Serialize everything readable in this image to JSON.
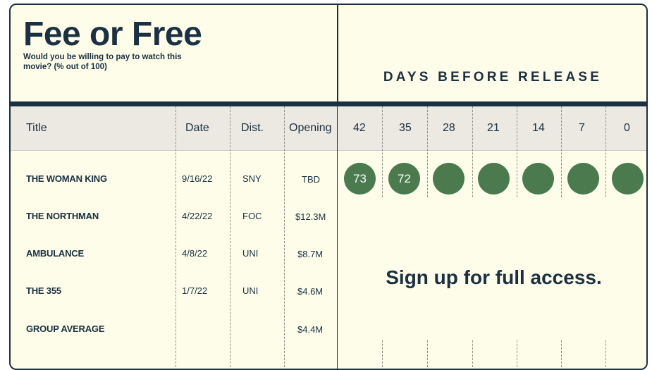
{
  "header": {
    "title": "Fee or Free",
    "subtitle": "Would you be willing to pay to watch this movie? (% out of 100)",
    "days_label": "DAYS BEFORE RELEASE"
  },
  "columns": {
    "title": "Title",
    "date": "Date",
    "dist": "Dist.",
    "opening": "Opening",
    "days": [
      "42",
      "35",
      "28",
      "21",
      "14",
      "7",
      "0"
    ]
  },
  "rows": [
    {
      "title": "THE WOMAN KING",
      "date": "9/16/22",
      "dist": "SNY",
      "opening": "TBD",
      "scores": [
        "73",
        "72",
        "",
        "",
        "",
        "",
        ""
      ]
    },
    {
      "title": "THE NORTHMAN",
      "date": "4/22/22",
      "dist": "FOC",
      "opening": "$12.3M"
    },
    {
      "title": "AMBULANCE",
      "date": "4/8/22",
      "dist": "UNI",
      "opening": "$8.7M"
    },
    {
      "title": "THE 355",
      "date": "1/7/22",
      "dist": "UNI",
      "opening": "$4.6M"
    },
    {
      "title": "GROUP AVERAGE",
      "date": "",
      "dist": "",
      "opening": "$4.4M"
    }
  ],
  "gate": {
    "message": "Sign up for full access."
  },
  "colors": {
    "ink": "#1b3042",
    "background": "#fdfde9",
    "score_circle": "#4a7a4e",
    "header_band": "#ebe9e2"
  }
}
